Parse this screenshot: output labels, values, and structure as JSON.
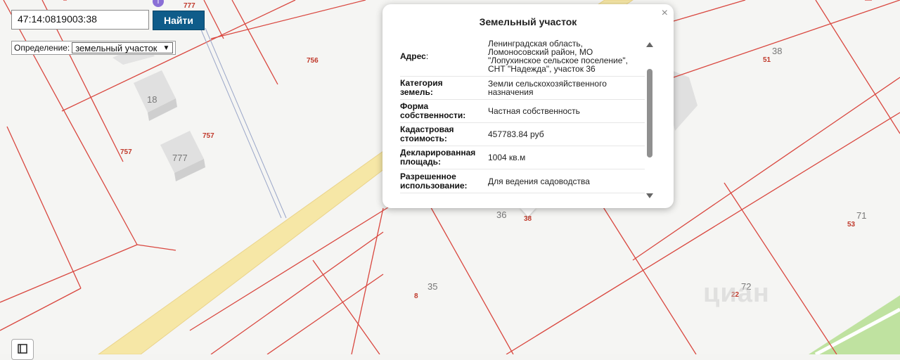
{
  "search": {
    "value": "47:14:0819003:38",
    "button_label": "Найти"
  },
  "definition": {
    "label": "Определение:",
    "selected": "земельный участок"
  },
  "popup": {
    "title": "Земельный участок",
    "rows": [
      {
        "key": [
          "Адрес",
          ":"
        ],
        "value": [
          "Ленинградская область,",
          "Ломоносовский район, МО",
          "\"Лопухинское сельское поселение\",",
          "СНТ \"Надежда\", участок 36"
        ]
      },
      {
        "key": [
          "Категория",
          "земель:"
        ],
        "value": [
          "Земли сельскохозяйственного",
          "назначения"
        ]
      },
      {
        "key": [
          "Форма",
          "собственности:"
        ],
        "value": [
          "Частная собственность"
        ]
      },
      {
        "key": [
          "Кадастровая",
          "стоимость:"
        ],
        "value": [
          "457783.84 руб"
        ]
      },
      {
        "key": [
          "Декларированная",
          "площадь:"
        ],
        "value": [
          "1004 кв.м"
        ]
      },
      {
        "key": [
          "Разрешенное",
          "использование:"
        ],
        "value": [
          "Для ведения садоводства"
        ]
      }
    ]
  },
  "map": {
    "red_labels": [
      "777",
      "756",
      "757",
      "757",
      "51",
      "38",
      "53",
      "8",
      "22"
    ],
    "gray_labels": [
      "18",
      "777",
      "38",
      "36",
      "71",
      "35",
      "72"
    ],
    "building_labels": [
      "18",
      "777"
    ]
  },
  "watermark": "циан",
  "colors": {
    "accent": "#0f5c8a",
    "parcel_line": "#d9473f",
    "road": "#f6e7a6"
  }
}
